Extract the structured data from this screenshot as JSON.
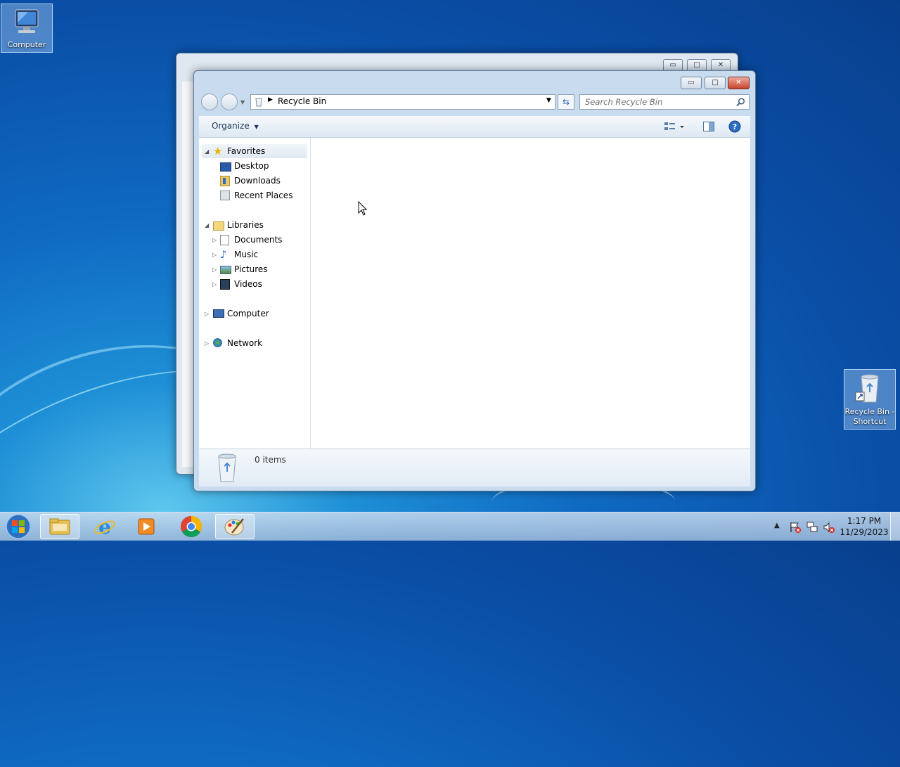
{
  "desktop": {
    "computer_icon": {
      "label": "Computer"
    },
    "recycle_shortcut": {
      "label": "Recycle Bin - Shortcut"
    }
  },
  "window": {
    "breadcrumb": "Recycle Bin",
    "search_placeholder": "Search Recycle Bin",
    "organize_label": "Organize",
    "status_text": "0 items",
    "caption_buttons": {
      "minimize": "▭",
      "maximize": "□",
      "close": "✕"
    }
  },
  "navigation": {
    "favorites": {
      "label": "Favorites",
      "items": [
        "Desktop",
        "Downloads",
        "Recent Places"
      ]
    },
    "libraries": {
      "label": "Libraries",
      "items": [
        "Documents",
        "Music",
        "Pictures",
        "Videos"
      ]
    },
    "computer": {
      "label": "Computer"
    },
    "network": {
      "label": "Network"
    }
  },
  "taskbar": {
    "clock_time": "1:17 PM",
    "clock_date": "11/29/2023",
    "apps": [
      "file-explorer",
      "internet-explorer",
      "media-player",
      "chrome",
      "paint"
    ]
  },
  "colors": {
    "accent": "#1e8fd6",
    "close_button": "#c8452f"
  }
}
